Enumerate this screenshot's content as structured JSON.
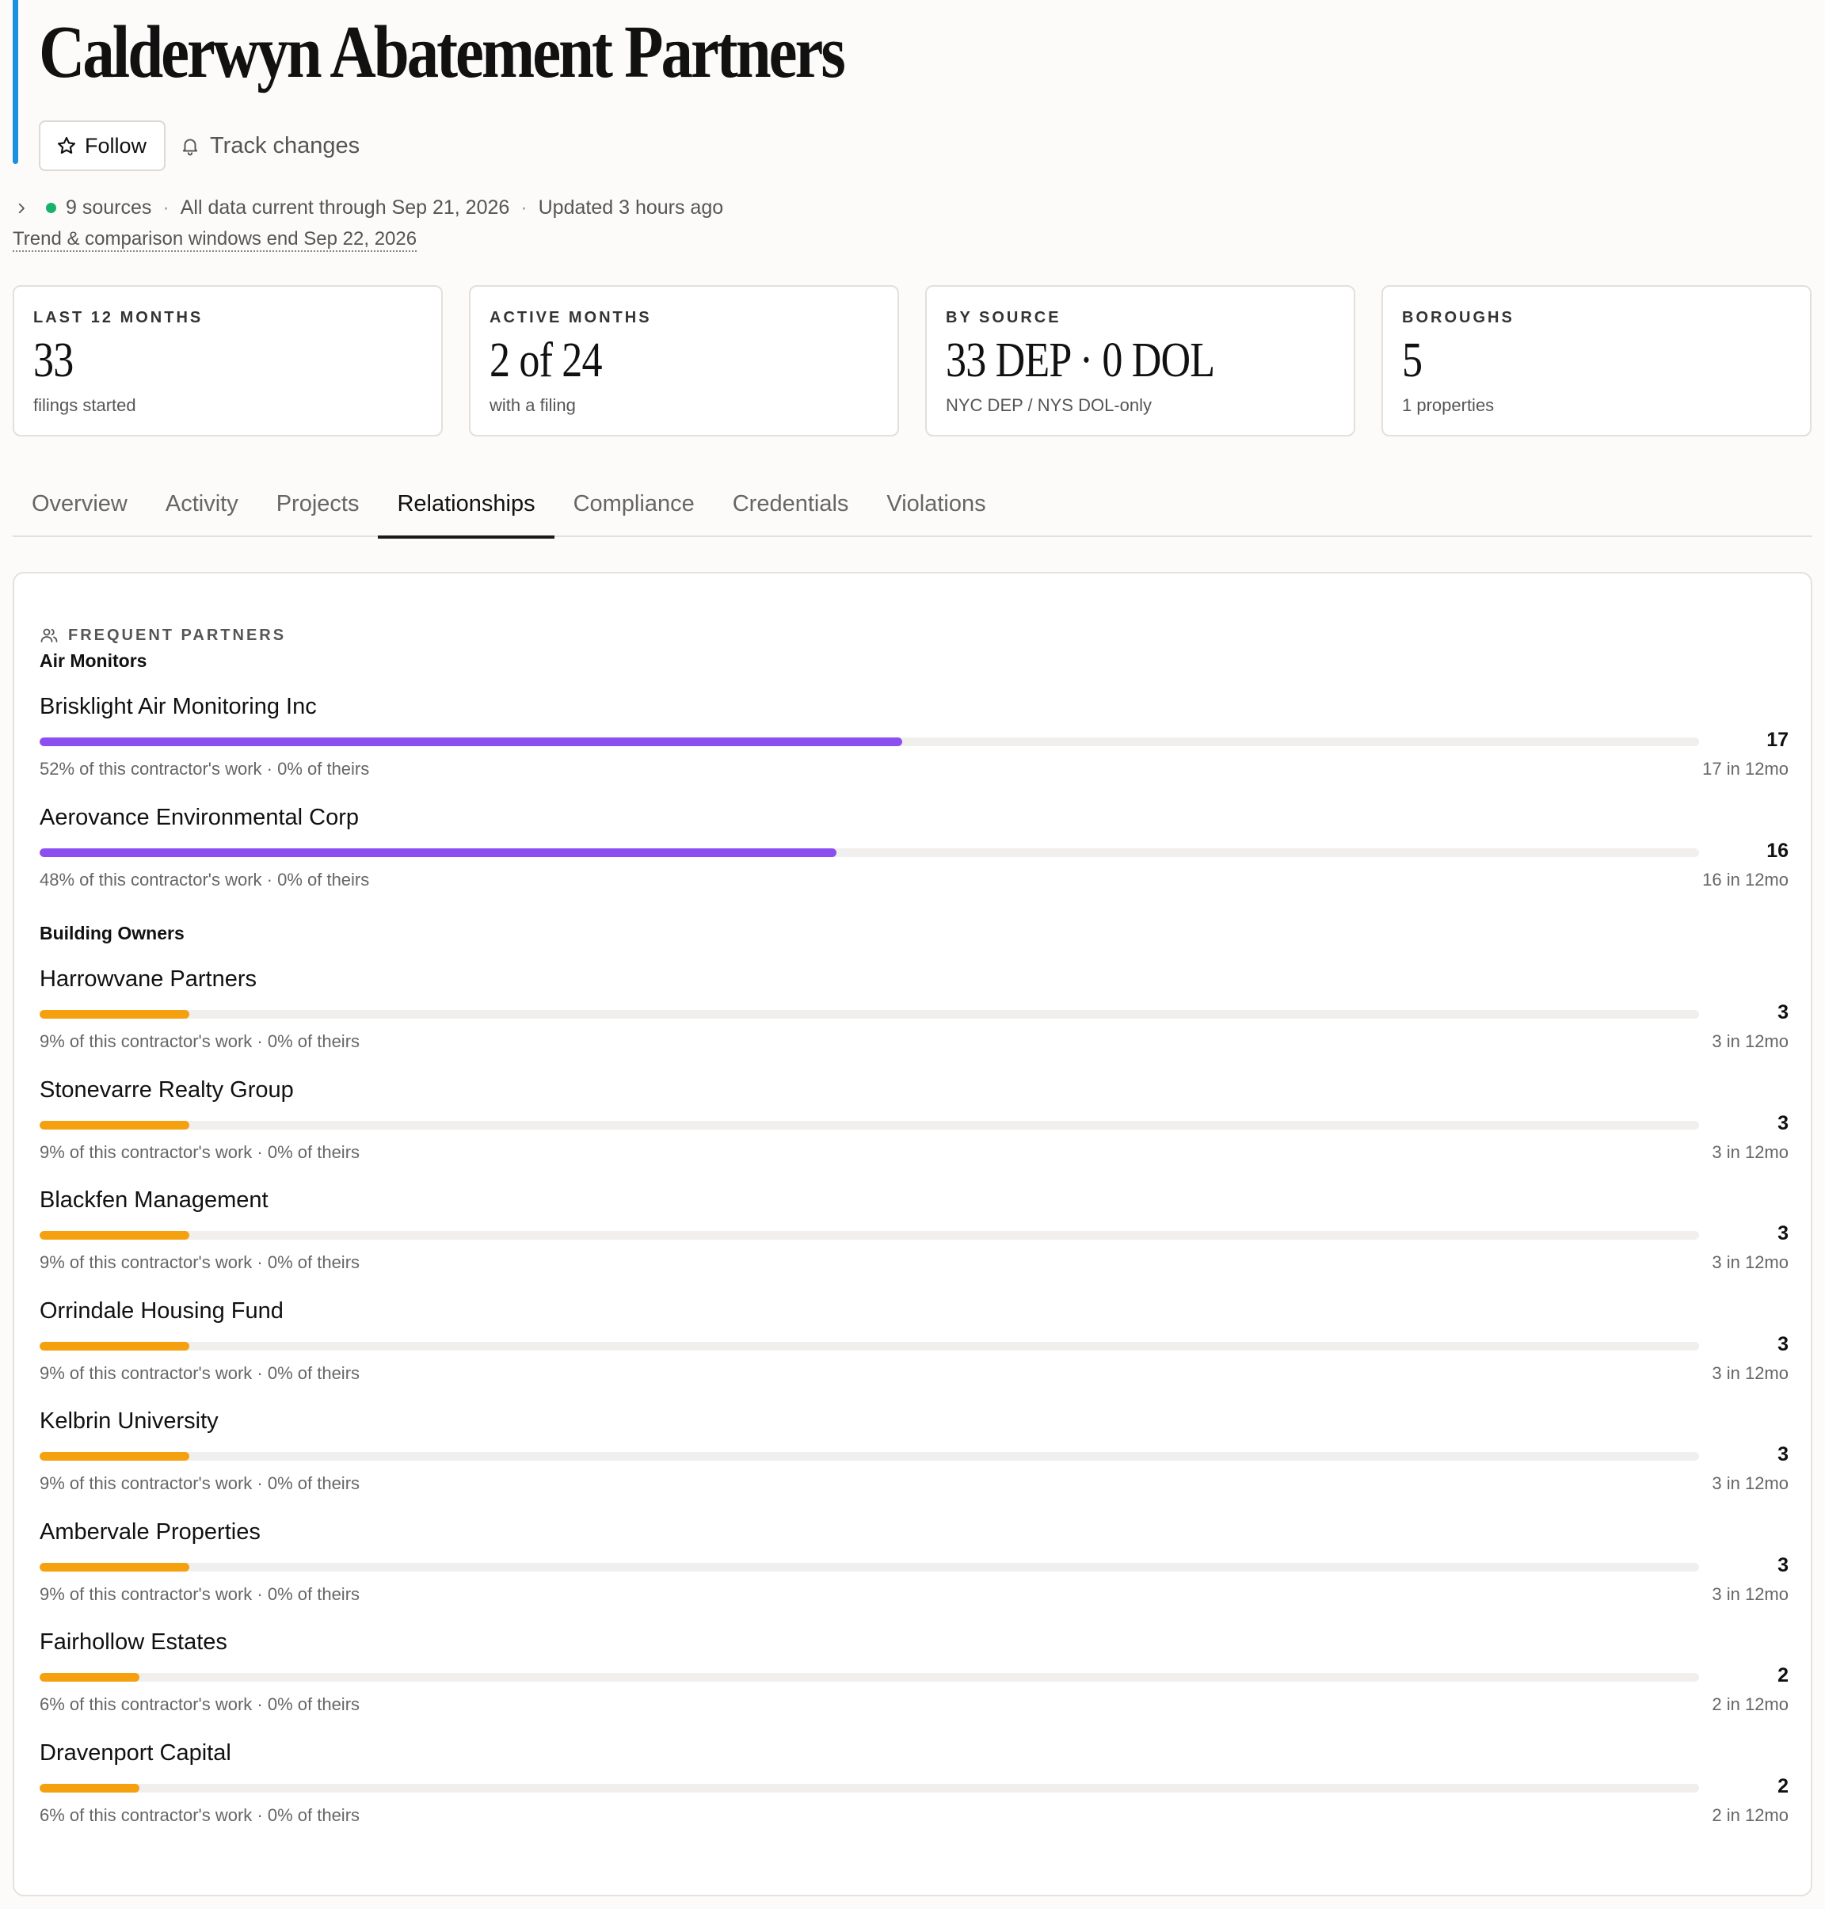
{
  "header": {
    "title": "Calderwyn Abatement Partners",
    "follow_label": "Follow",
    "track_label": "Track changes"
  },
  "meta": {
    "sources": "9 sources",
    "current": "All data current through Sep 21, 2026",
    "updated": "Updated 3 hours ago",
    "separator": "·",
    "window_note": "Trend & comparison windows end Sep 22, 2026"
  },
  "stats": [
    {
      "label": "LAST 12 MONTHS",
      "value": "33",
      "sub": "filings started"
    },
    {
      "label": "ACTIVE MONTHS",
      "value": "2 of 24",
      "sub": "with a filing"
    },
    {
      "label": "BY SOURCE",
      "value": "33 DEP · 0 DOL",
      "sub": "NYC DEP / NYS DOL-only"
    },
    {
      "label": "BOROUGHS",
      "value": "5",
      "sub": "1 properties"
    }
  ],
  "tabs": [
    {
      "label": "Overview"
    },
    {
      "label": "Activity"
    },
    {
      "label": "Projects"
    },
    {
      "label": "Relationships"
    },
    {
      "label": "Compliance"
    },
    {
      "label": "Credentials"
    },
    {
      "label": "Violations"
    }
  ],
  "active_tab": "Relationships",
  "partners_panel": {
    "heading": "FREQUENT PARTNERS",
    "groups": [
      {
        "label": "Air Monitors",
        "color": "#8b4ff0",
        "partners": [
          {
            "name": "Brisklight Air Monitoring Inc",
            "count": "17",
            "share_pct": 52,
            "share_text": "52% of this contractor's work · 0% of theirs",
            "recent": "17 in 12mo"
          },
          {
            "name": "Aerovance Environmental Corp",
            "count": "16",
            "share_pct": 48,
            "share_text": "48% of this contractor's work · 0% of theirs",
            "recent": "16 in 12mo"
          }
        ]
      },
      {
        "label": "Building Owners",
        "color": "#f5a00f",
        "partners": [
          {
            "name": "Harrowvane Partners",
            "count": "3",
            "share_pct": 9,
            "share_text": "9% of this contractor's work · 0% of theirs",
            "recent": "3 in 12mo"
          },
          {
            "name": "Stonevarre Realty Group",
            "count": "3",
            "share_pct": 9,
            "share_text": "9% of this contractor's work · 0% of theirs",
            "recent": "3 in 12mo"
          },
          {
            "name": "Blackfen Management",
            "count": "3",
            "share_pct": 9,
            "share_text": "9% of this contractor's work · 0% of theirs",
            "recent": "3 in 12mo"
          },
          {
            "name": "Orrindale Housing Fund",
            "count": "3",
            "share_pct": 9,
            "share_text": "9% of this contractor's work · 0% of theirs",
            "recent": "3 in 12mo"
          },
          {
            "name": "Kelbrin University",
            "count": "3",
            "share_pct": 9,
            "share_text": "9% of this contractor's work · 0% of theirs",
            "recent": "3 in 12mo"
          },
          {
            "name": "Ambervale Properties",
            "count": "3",
            "share_pct": 9,
            "share_text": "9% of this contractor's work · 0% of theirs",
            "recent": "3 in 12mo"
          },
          {
            "name": "Fairhollow Estates",
            "count": "2",
            "share_pct": 6,
            "share_text": "6% of this contractor's work · 0% of theirs",
            "recent": "2 in 12mo"
          },
          {
            "name": "Dravenport Capital",
            "count": "2",
            "share_pct": 6,
            "share_text": "6% of this contractor's work · 0% of theirs",
            "recent": "2 in 12mo"
          }
        ]
      }
    ]
  },
  "icons": {
    "follow": "star-icon",
    "track": "bell-icon",
    "meta_toggle": "chevron-right-icon",
    "status": "status-dot-icon",
    "panel": "people-icon"
  },
  "colors": {
    "accent": "#1b8fe0",
    "status_ok": "#18b26b",
    "air_monitors": "#8b4ff0",
    "building_owners": "#f5a00f"
  }
}
